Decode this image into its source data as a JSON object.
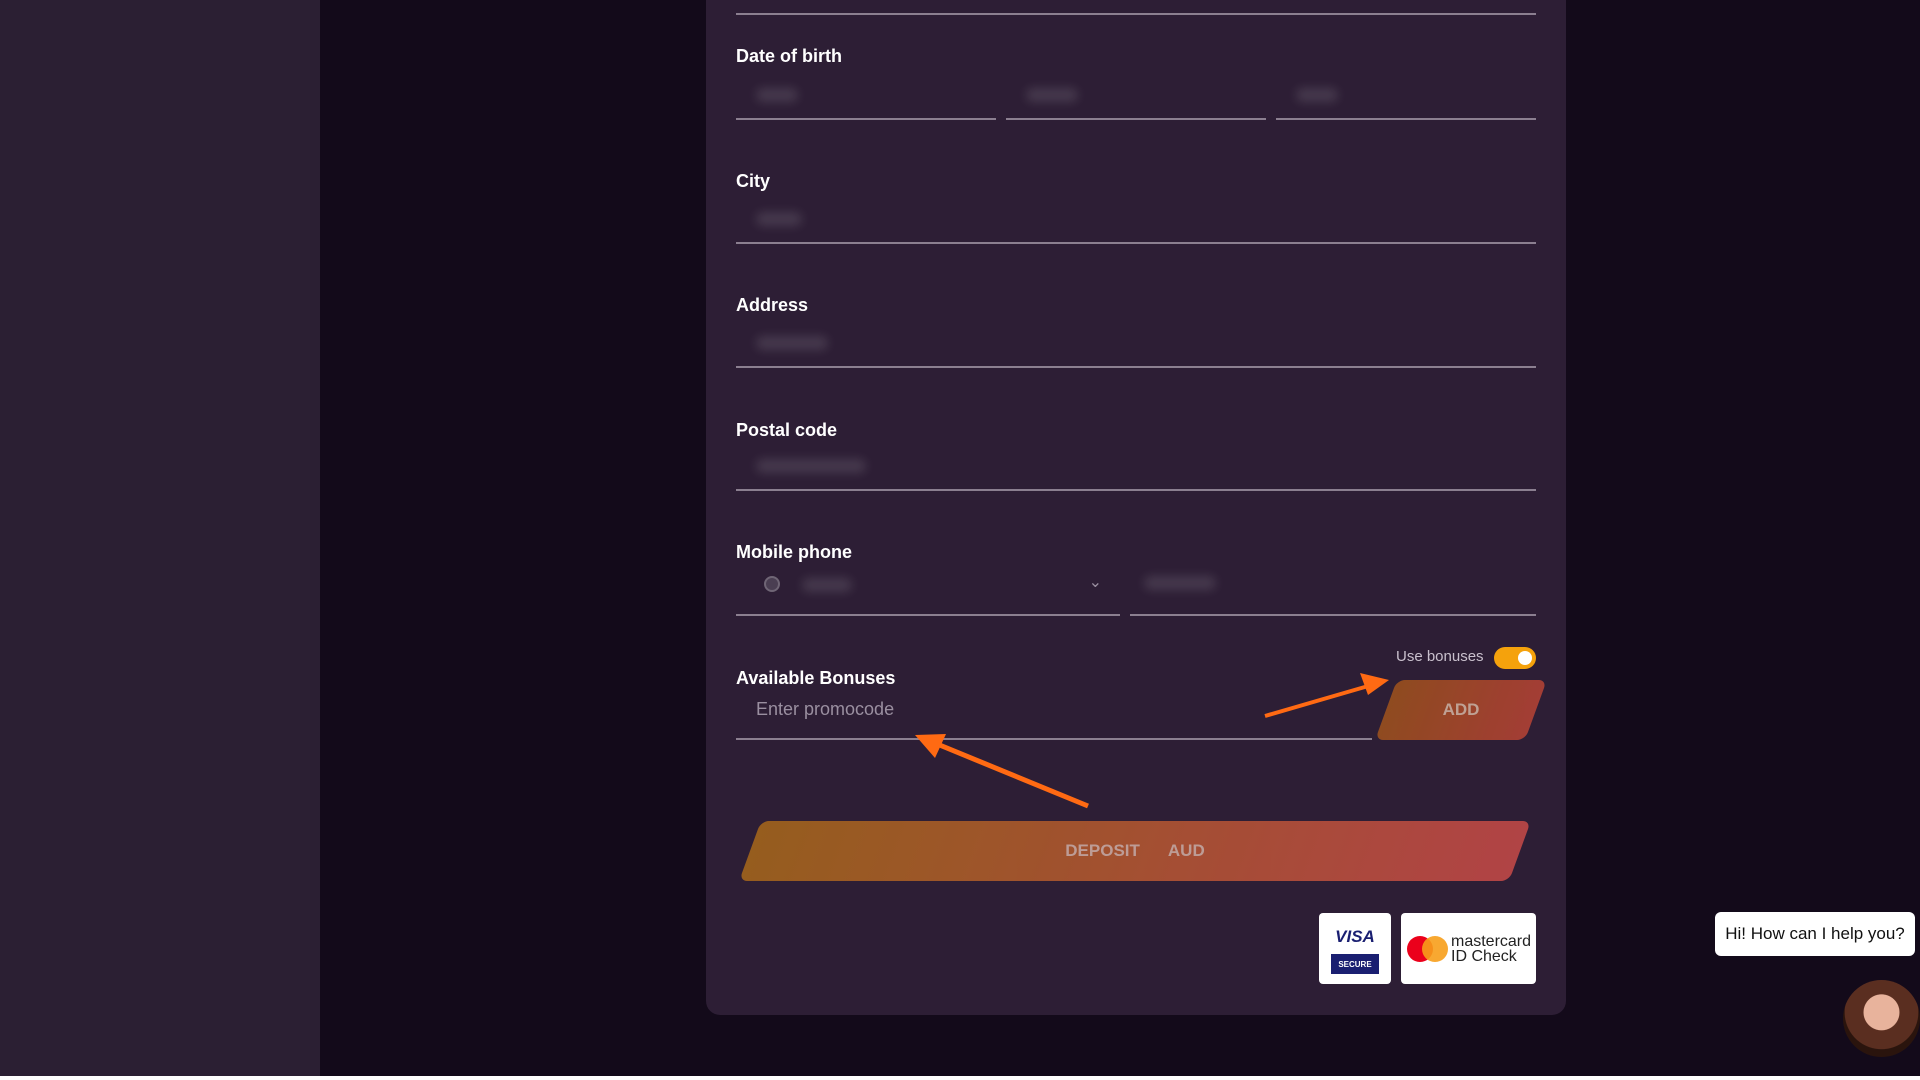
{
  "form": {
    "date_of_birth_label": "Date of birth",
    "city_label": "City",
    "address_label": "Address",
    "postal_code_label": "Postal code",
    "mobile_phone_label": "Mobile phone",
    "available_bonuses_label": "Available Bonuses",
    "use_bonuses_label": "Use bonuses",
    "use_bonuses_on": true,
    "promocode_placeholder": "Enter promocode",
    "add_label": "ADD",
    "deposit_label": "DEPOSIT",
    "currency_label": "AUD"
  },
  "payment_badges": {
    "visa_word": "VISA",
    "visa_sub": "SECURE",
    "mastercard_word": "mastercard",
    "mastercard_sub": "ID Check"
  },
  "chat": {
    "greeting": "Hi! How can I help you?"
  },
  "colors": {
    "background": "#130a1a",
    "card": "#2d1e35",
    "accent_toggle": "#f5a20c",
    "annotation_arrow": "#ff6a13"
  },
  "icons": [
    "globe-icon",
    "chevron-down-icon",
    "visa-logo",
    "mastercard-logo",
    "annotation-arrow"
  ]
}
